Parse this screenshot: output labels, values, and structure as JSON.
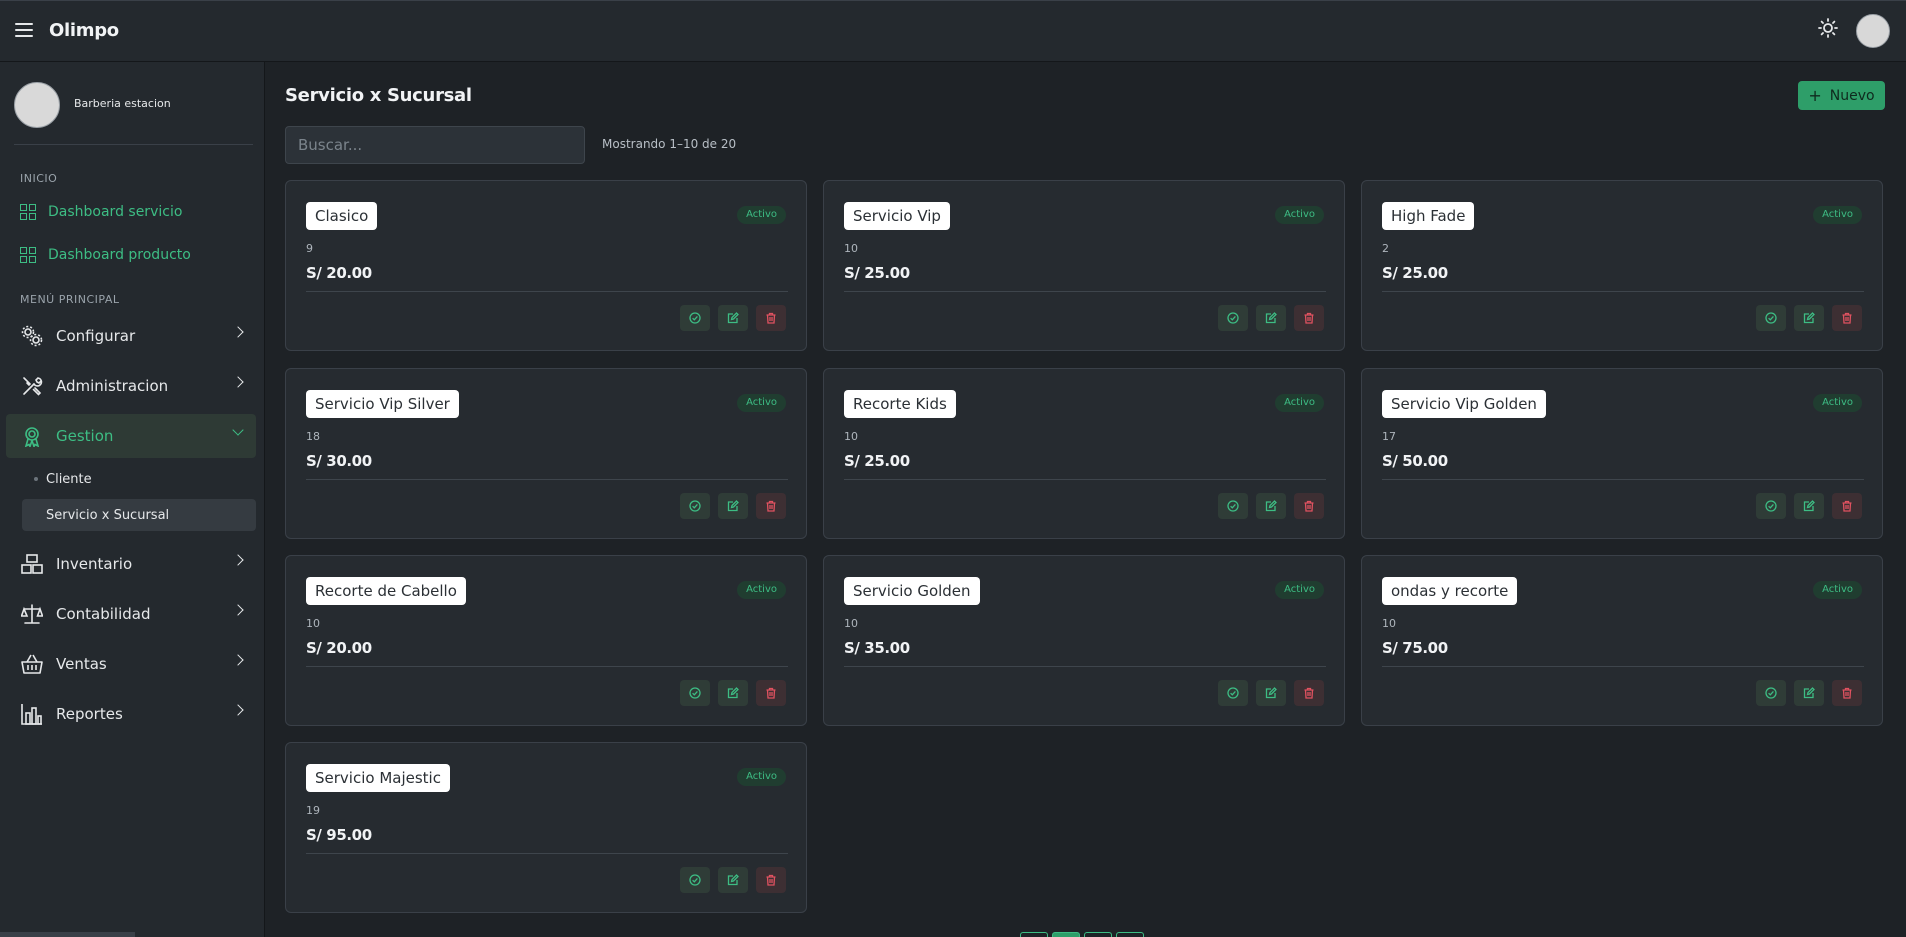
{
  "app": {
    "brand": "Olimpo"
  },
  "user": {
    "name": "Barberia estacion"
  },
  "sidebar": {
    "section_inicio": "INICIO",
    "dashboards": [
      {
        "label": "Dashboard servicio"
      },
      {
        "label": "Dashboard producto"
      }
    ],
    "section_main": "MENÚ PRINCIPAL",
    "items": [
      {
        "label": "Configurar",
        "icon": "cogs-icon"
      },
      {
        "label": "Administracion",
        "icon": "tools-icon"
      },
      {
        "label": "Gestion",
        "icon": "award-icon"
      },
      {
        "label": "Inventario",
        "icon": "boxes-icon"
      },
      {
        "label": "Contabilidad",
        "icon": "scale-icon"
      },
      {
        "label": "Ventas",
        "icon": "basket-icon"
      },
      {
        "label": "Reportes",
        "icon": "bar-chart-icon"
      }
    ],
    "gestion_sub": [
      {
        "label": "Cliente"
      },
      {
        "label": "Servicio x Sucursal"
      }
    ]
  },
  "page": {
    "title": "Servicio x Sucursal",
    "new_label": "Nuevo",
    "search_placeholder": "Buscar...",
    "count": "Mostrando 1–10 de 20"
  },
  "cards": [
    {
      "name": "Clasico",
      "num": "9",
      "price": "S/ 20.00",
      "status": "Activo"
    },
    {
      "name": "Servicio Vip",
      "num": "10",
      "price": "S/ 25.00",
      "status": "Activo"
    },
    {
      "name": "High Fade",
      "num": "2",
      "price": "S/ 25.00",
      "status": "Activo"
    },
    {
      "name": "Servicio Vip Silver",
      "num": "18",
      "price": "S/ 30.00",
      "status": "Activo"
    },
    {
      "name": "Recorte Kids",
      "num": "10",
      "price": "S/ 25.00",
      "status": "Activo"
    },
    {
      "name": "Servicio Vip Golden",
      "num": "17",
      "price": "S/ 50.00",
      "status": "Activo"
    },
    {
      "name": "Recorte de Cabello",
      "num": "10",
      "price": "S/ 20.00",
      "status": "Activo"
    },
    {
      "name": "Servicio Golden",
      "num": "10",
      "price": "S/ 35.00",
      "status": "Activo"
    },
    {
      "name": "ondas y recorte",
      "num": "10",
      "price": "S/ 75.00",
      "status": "Activo"
    },
    {
      "name": "Servicio Majestic",
      "num": "19",
      "price": "S/ 95.00",
      "status": "Activo"
    }
  ],
  "colors": {
    "accent": "#3dbd84",
    "danger": "#e05260",
    "background": "#1e2226",
    "panel": "#24292e"
  }
}
